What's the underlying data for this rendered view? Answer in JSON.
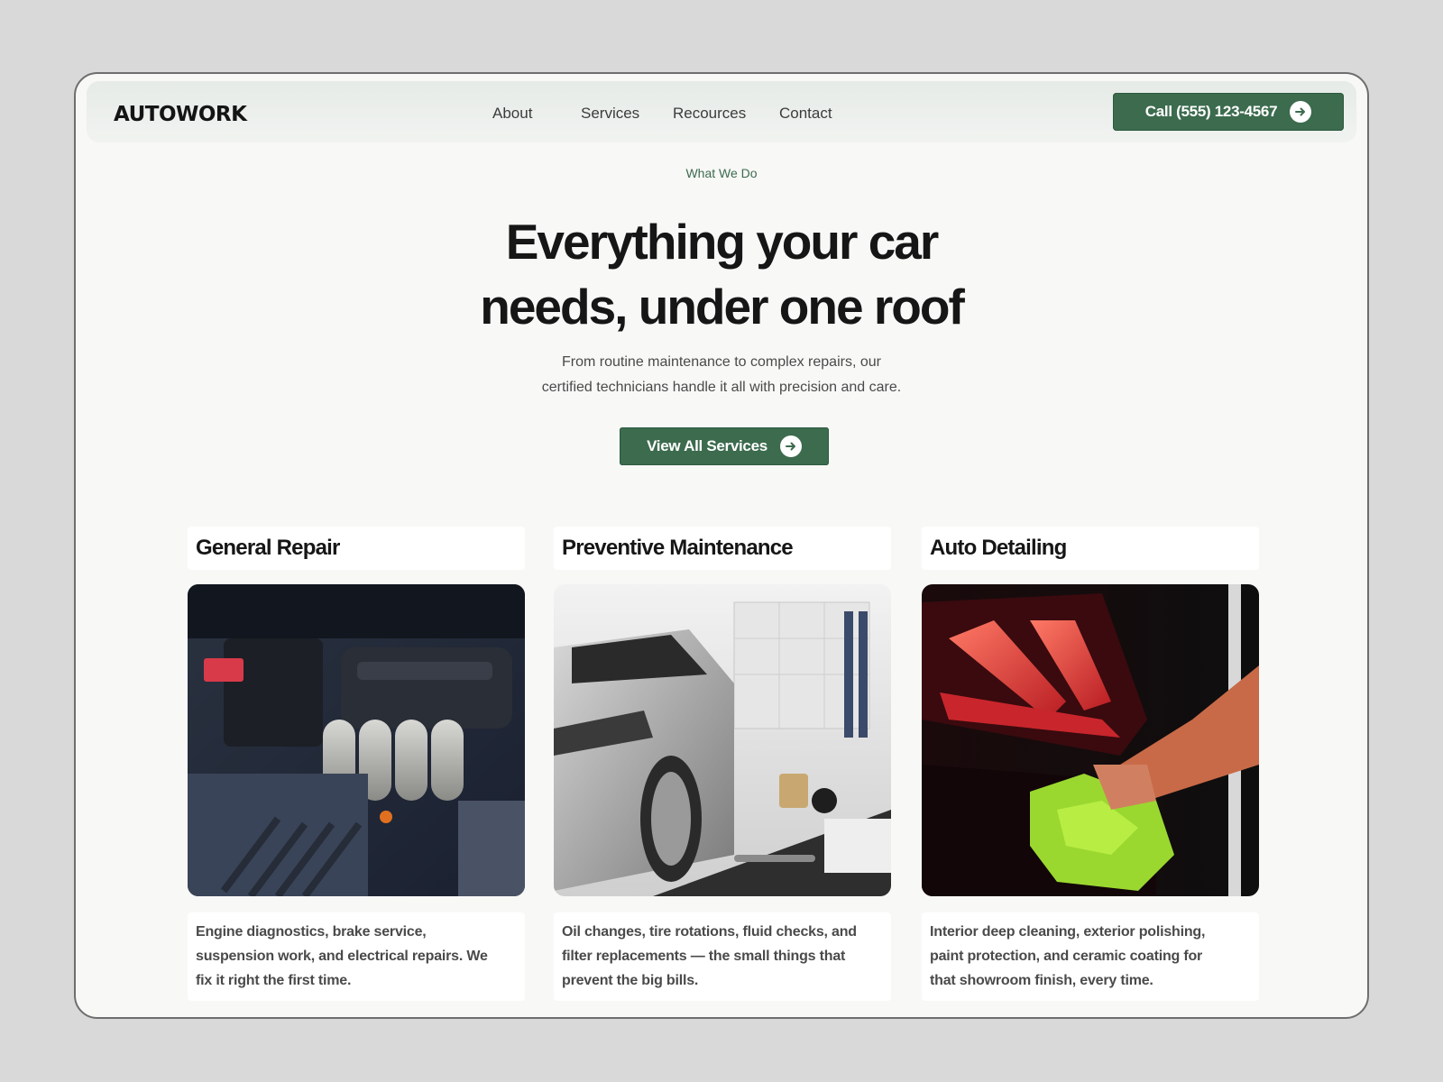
{
  "nav": {
    "logo": "AUTOWORK",
    "links": [
      "About",
      "Services",
      "Recources",
      "Contact"
    ],
    "call_label": "Call (555) 123-4567"
  },
  "hero": {
    "eyebrow": "What We Do",
    "headline_line1": "Everything your car",
    "headline_line2": "needs, under one roof",
    "subtext_line1": "From routine maintenance to complex repairs, our",
    "subtext_line2": "certified technicians handle it all with precision and care.",
    "cta_label": "View All Services"
  },
  "services": [
    {
      "title": "General Repair",
      "image": "engine-bay-photo",
      "desc_lines": [
        "Engine diagnostics, brake service,",
        "suspension work, and electrical repairs. We",
        "fix it right the first time."
      ]
    },
    {
      "title": "Preventive Maintenance",
      "image": "silver-car-garage-photo",
      "desc_lines": [
        "Oil changes, tire rotations, fluid checks, and",
        "filter replacements — the small things that",
        "prevent the big bills."
      ]
    },
    {
      "title": "Auto Detailing",
      "image": "taillight-polishing-photo",
      "desc_lines": [
        "Interior deep cleaning, exterior polishing,",
        "paint protection, and ceramic coating for",
        "that showroom finish, every time."
      ]
    }
  ],
  "colors": {
    "accent": "#3c6b4e",
    "background": "#f8f8f6",
    "outer": "#d9d9d9"
  }
}
